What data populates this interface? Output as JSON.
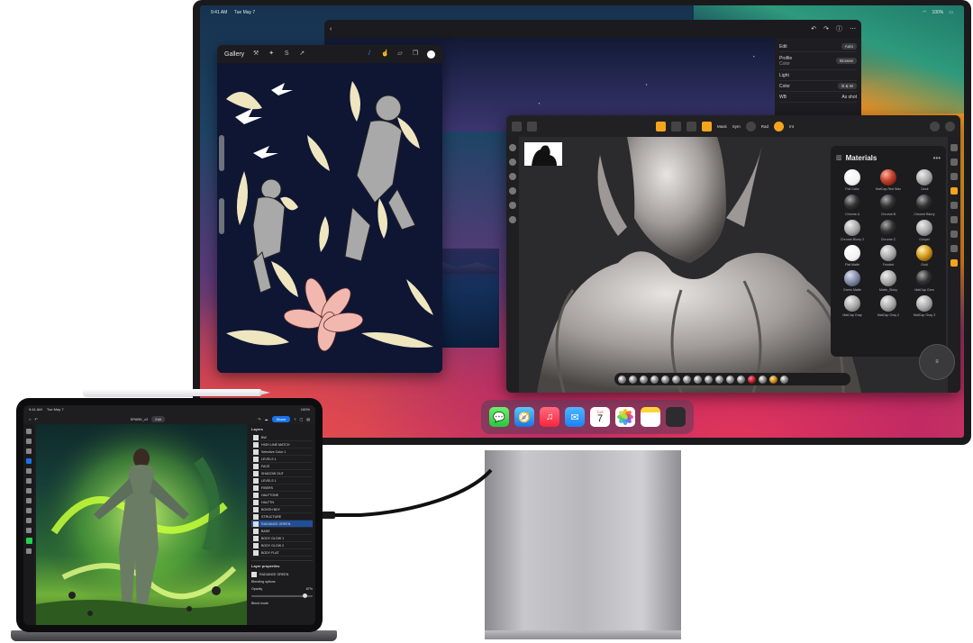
{
  "monitor": {
    "status": {
      "time": "9:41 AM",
      "date": "Tue May 7",
      "battery": "100%"
    },
    "bg_app": {
      "panel": {
        "edit": "Edit",
        "edit_value": "Auto",
        "profile": "Profile",
        "profile_sub": "Color",
        "profile_button": "Browse",
        "light": "Light",
        "color": "Color",
        "color_value": "B & W",
        "wb": "WB",
        "wb_value": "As shot"
      }
    },
    "procreate": {
      "gallery": "Gallery",
      "tools": [
        "wrench-icon",
        "magic-wand-icon",
        "selection-icon",
        "transform-icon"
      ],
      "right_tools": [
        "brush-icon",
        "smudge-icon",
        "eraser-icon",
        "layers-icon"
      ],
      "color": "#ffffff"
    },
    "nomad": {
      "toolbar_labels": [
        "Mask",
        "Sym",
        "Rad",
        "Int"
      ],
      "materials": {
        "title": "Materials",
        "more": "•••",
        "items": [
          {
            "name": "Full Color",
            "style": "white"
          },
          {
            "name": "MatCap Red Wax",
            "style": "red"
          },
          {
            "name": "Clock",
            "style": "clay"
          },
          {
            "name": "Chrome A",
            "style": "dark"
          },
          {
            "name": "Chrome B",
            "style": "dark"
          },
          {
            "name": "Chrome Blurry",
            "style": "dark"
          },
          {
            "name": "Chrome Blurry 2",
            "style": "clay"
          },
          {
            "name": "Chrome C",
            "style": "dark"
          },
          {
            "name": "Gospel",
            "style": "clay"
          },
          {
            "name": "Flat Matte",
            "style": "white"
          },
          {
            "name": "Frosted",
            "style": "clay"
          },
          {
            "name": "Gold",
            "style": "gold"
          },
          {
            "name": "Green Matte",
            "style": "blue"
          },
          {
            "name": "Matte_Shiny",
            "style": "clay"
          },
          {
            "name": "MatCap Gem",
            "style": "dark"
          },
          {
            "name": "MatCap Gray",
            "style": "clay"
          },
          {
            "name": "MatCap Gray 2",
            "style": "clay"
          },
          {
            "name": "MatCap Gray 3",
            "style": "clay"
          }
        ]
      },
      "gizmo": "≡"
    },
    "dock": [
      {
        "name": "messages-app",
        "glyph": "💬"
      },
      {
        "name": "safari-app",
        "glyph": "🧭"
      },
      {
        "name": "music-app",
        "glyph": "♫"
      },
      {
        "name": "mail-app",
        "glyph": "✉"
      },
      {
        "name": "calendar-app",
        "glyph": "TUE",
        "num": "7"
      },
      {
        "name": "photos-app",
        "glyph": "✿"
      },
      {
        "name": "notes-app",
        "glyph": ""
      },
      {
        "name": "app-library",
        "glyph": ""
      }
    ]
  },
  "ipad": {
    "status": {
      "time": "9:41 AM",
      "date": "Tue May 7",
      "battery": "100%"
    },
    "doc_title": "SPARK_v2",
    "doc_badge": "Edit",
    "share": "Share",
    "layers_title": "Layers",
    "layers": [
      "BW",
      "HIGH LINE MATCH",
      "Selective Color 1",
      "LEVELS 1",
      "FACE",
      "SHADOW OUT",
      "LEVELS 1",
      "FIBERS",
      "HALFTONE",
      "HALFTN",
      "BOKEH BDY",
      "STRUCTURE",
      "RADIANCE GREEN",
      "BASE",
      "BODY GLOW 1",
      "BODY GLOW 2",
      "BODY FLAT"
    ],
    "selected_layer_index": 12,
    "props_title": "Layer properties",
    "props_layer": "RADIANCE GREEN",
    "blending_options": "Blending options",
    "opacity_label": "Opacity",
    "opacity_value": "87%",
    "blend_mode_label": "Blend mode",
    "accent": "#1a73e8",
    "swatch": "#23d14a"
  }
}
